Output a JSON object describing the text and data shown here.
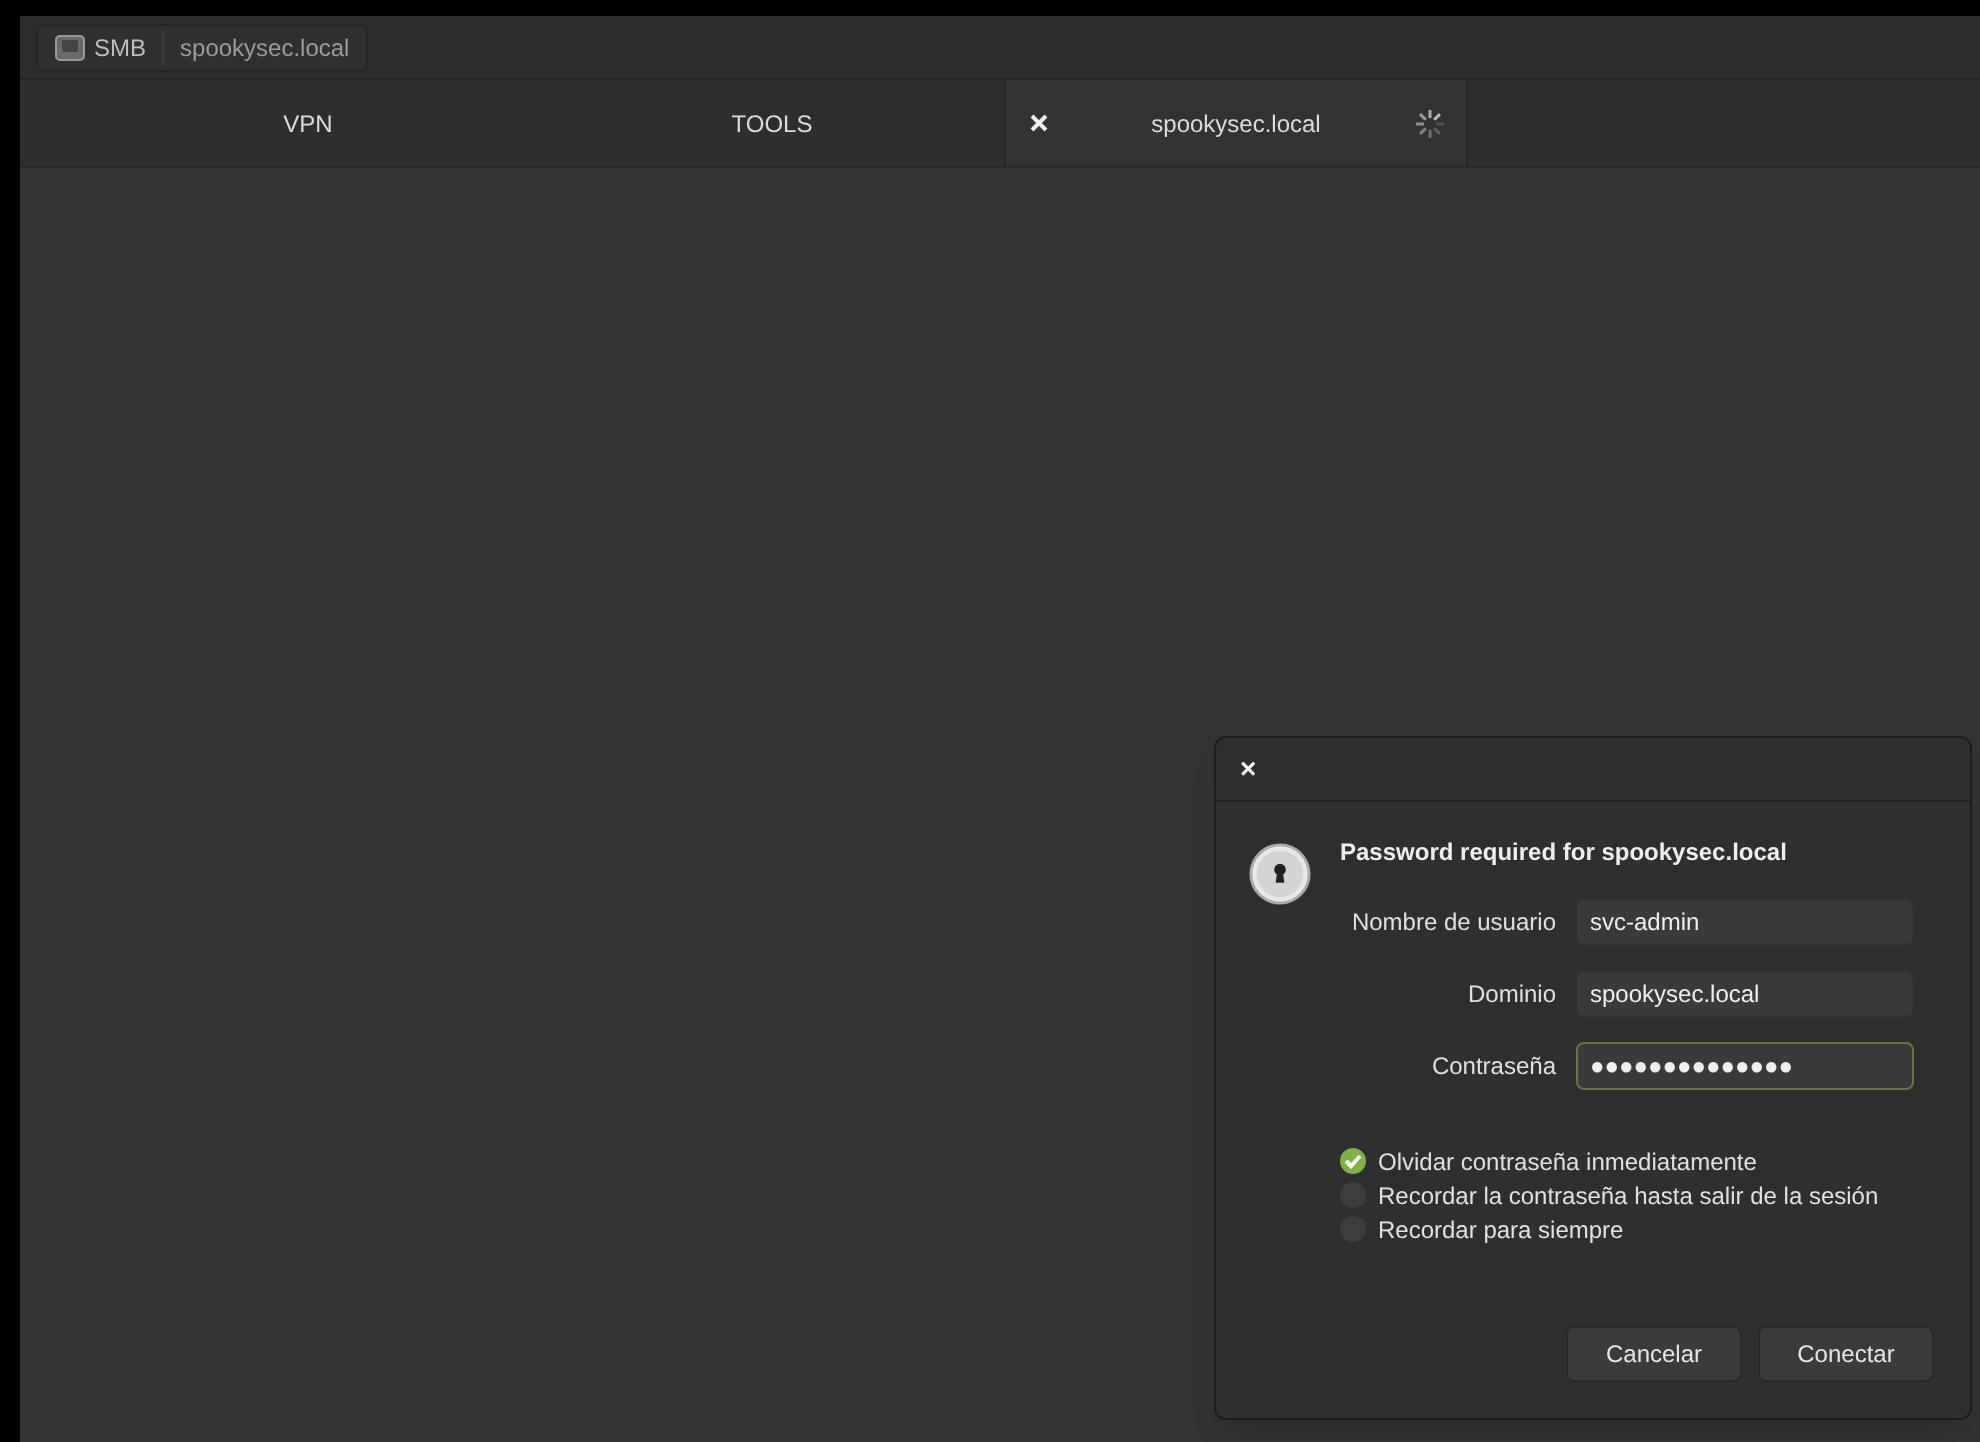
{
  "breadcrumb": [
    {
      "label": "SMB"
    },
    {
      "label": "spookysec.local"
    }
  ],
  "tabs": [
    {
      "label": "VPN",
      "selected": false,
      "loading": false
    },
    {
      "label": "TOOLS",
      "selected": false,
      "loading": false
    },
    {
      "label": "spookysec.local",
      "selected": true,
      "loading": true
    }
  ],
  "dialog": {
    "close": "×",
    "title": "Password required for spookysec.local",
    "fields": [
      {
        "label": "Nombre de usuario",
        "value": "svc-admin",
        "focused": false
      },
      {
        "label": "Dominio",
        "value": "spookysec.local",
        "focused": false
      },
      {
        "label": "Contraseña",
        "value": "●●●●●●●●●●●●●●",
        "focused": true
      }
    ],
    "options": [
      {
        "label": "Olvidar contraseña inmediatamente",
        "selected": true
      },
      {
        "label": "Recordar la contraseña hasta salir de la sesión",
        "selected": false
      },
      {
        "label": "Recordar para siempre",
        "selected": false
      }
    ],
    "buttons": [
      "Cancelar",
      "Conectar"
    ]
  }
}
